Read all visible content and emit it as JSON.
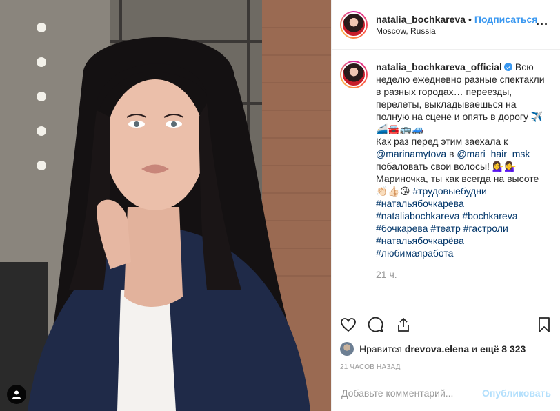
{
  "photo": {
    "tag_icon": "user-tag-icon"
  },
  "header": {
    "username": "natalia_bochkareva",
    "separator": "•",
    "follow_label": "Подписаться",
    "location": "Moscow, Russia",
    "more_label": "···"
  },
  "caption": {
    "username": "natalia_bochkareva_official",
    "text_1": "Всю неделю ежедневно разные спектакли в разных городах… переезды, перелеты, выкладываешься на полную на сцене и опять в дорогу ✈️🚄🚘🚌🚙",
    "text_2a": "Как раз перед этим заехала к ",
    "mention_1": "@marinamytova",
    "text_2b": " в ",
    "mention_2": "@mari_hair_msk",
    "text_2c": " побаловать свои волосы! 💁‍♀️💁‍♀️",
    "text_3": "Мариночка, ты как всегда на высоте 👏🏻👍🏻😘 ",
    "hashtags": [
      "#трудовыебудни",
      "#натальябочкарева",
      "#nataliabochkareva",
      "#bochkareva",
      "#бочкарева",
      "#театр",
      "#гастроли",
      "#натальябочкарёва",
      "#любимаяработа"
    ],
    "time_ago": "21 ч."
  },
  "actions": {
    "icons": [
      "heart-icon",
      "comment-icon",
      "share-icon",
      "bookmark-icon"
    ]
  },
  "likes": {
    "prefix": "Нравится",
    "user": "drevova.elena",
    "middle": "и",
    "count": "ещё 8 323"
  },
  "date": "21 ЧАСОВ НАЗАД",
  "comment": {
    "placeholder": "Добавьте комментарий...",
    "post_label": "Опубликовать"
  },
  "colors": {
    "accent": "#3897f0",
    "link": "#003569",
    "muted": "#999999",
    "post_disabled": "#b2dffc"
  }
}
